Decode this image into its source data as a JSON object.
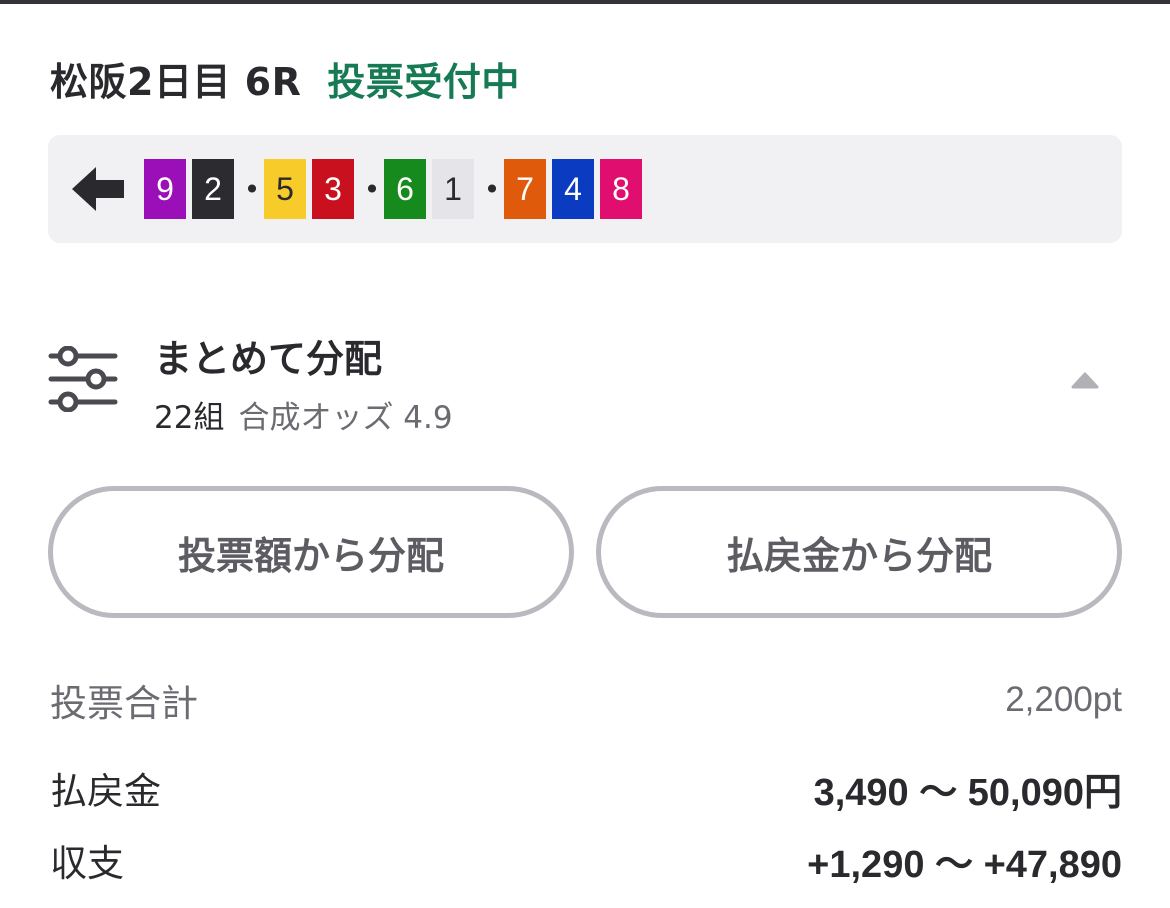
{
  "header": {
    "race_title": "松阪2日目 6R",
    "status": "投票受付中",
    "status_color": "#167a55"
  },
  "combination": {
    "arrow_icon": "arrow-left-icon",
    "groups": [
      [
        {
          "number": "9",
          "bg": "#9b0fb8",
          "fg": "#ffffff"
        },
        {
          "number": "2",
          "bg": "#2b2b30",
          "fg": "#ffffff"
        }
      ],
      [
        {
          "number": "5",
          "bg": "#f7cc2a",
          "fg": "#2a2a2e"
        },
        {
          "number": "3",
          "bg": "#c8101e",
          "fg": "#ffffff"
        }
      ],
      [
        {
          "number": "6",
          "bg": "#168a1c",
          "fg": "#ffffff"
        },
        {
          "number": "1",
          "bg": "#e4e4e9",
          "fg": "#2a2a2e"
        }
      ],
      [
        {
          "number": "7",
          "bg": "#e05a0c",
          "fg": "#ffffff"
        },
        {
          "number": "4",
          "bg": "#0a3bc0",
          "fg": "#ffffff"
        },
        {
          "number": "8",
          "bg": "#e00e6e",
          "fg": "#ffffff"
        }
      ]
    ],
    "separator": "•"
  },
  "distribution": {
    "icon": "sliders-icon",
    "title": "まとめて分配",
    "count": "22組",
    "odds": "合成オッズ 4.9",
    "toggle_icon": "caret-up-icon"
  },
  "buttons": {
    "by_bet": "投票額から分配",
    "by_payout": "払戻金から分配"
  },
  "summary": {
    "total_label": "投票合計",
    "total_value": "2,200pt",
    "payout_label": "払戻金",
    "payout_value": "3,490 〜 50,090円",
    "balance_label": "収支",
    "balance_value": "+1,290 〜 +47,890"
  }
}
